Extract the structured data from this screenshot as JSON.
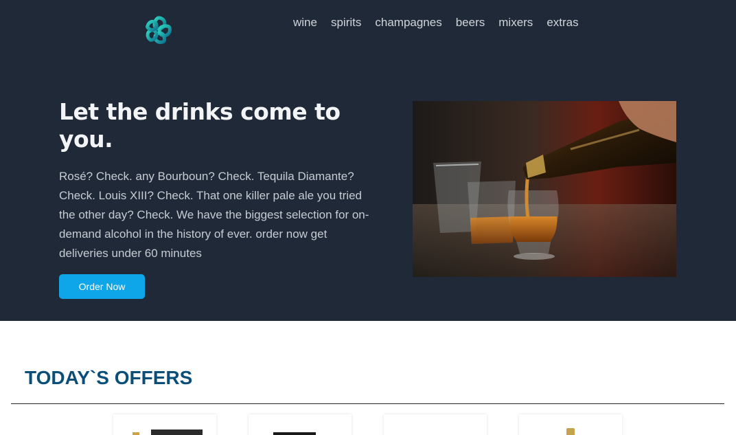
{
  "nav": {
    "items": [
      "wine",
      "spirits",
      "champagnes",
      "beers",
      "mixers",
      "extras"
    ]
  },
  "hero": {
    "title": "Let the drinks come to you.",
    "description": "Rosé? Check. any Bourboun? Check. Tequila Diamante? Check. Louis XIII? Check. That one killer pale ale you tried the other day? Check. We have the biggest selection for on-demand alcohol in the history of ever. order now get deliveries under 60 minutes",
    "cta_label": "Order Now"
  },
  "offers": {
    "title": "TODAY`S OFFERS"
  },
  "colors": {
    "hero_background": "#1f2937",
    "accent": "#0ea5e9",
    "offers_title": "#0b4f79"
  },
  "icons": {
    "logo": "knot-logo-icon"
  }
}
